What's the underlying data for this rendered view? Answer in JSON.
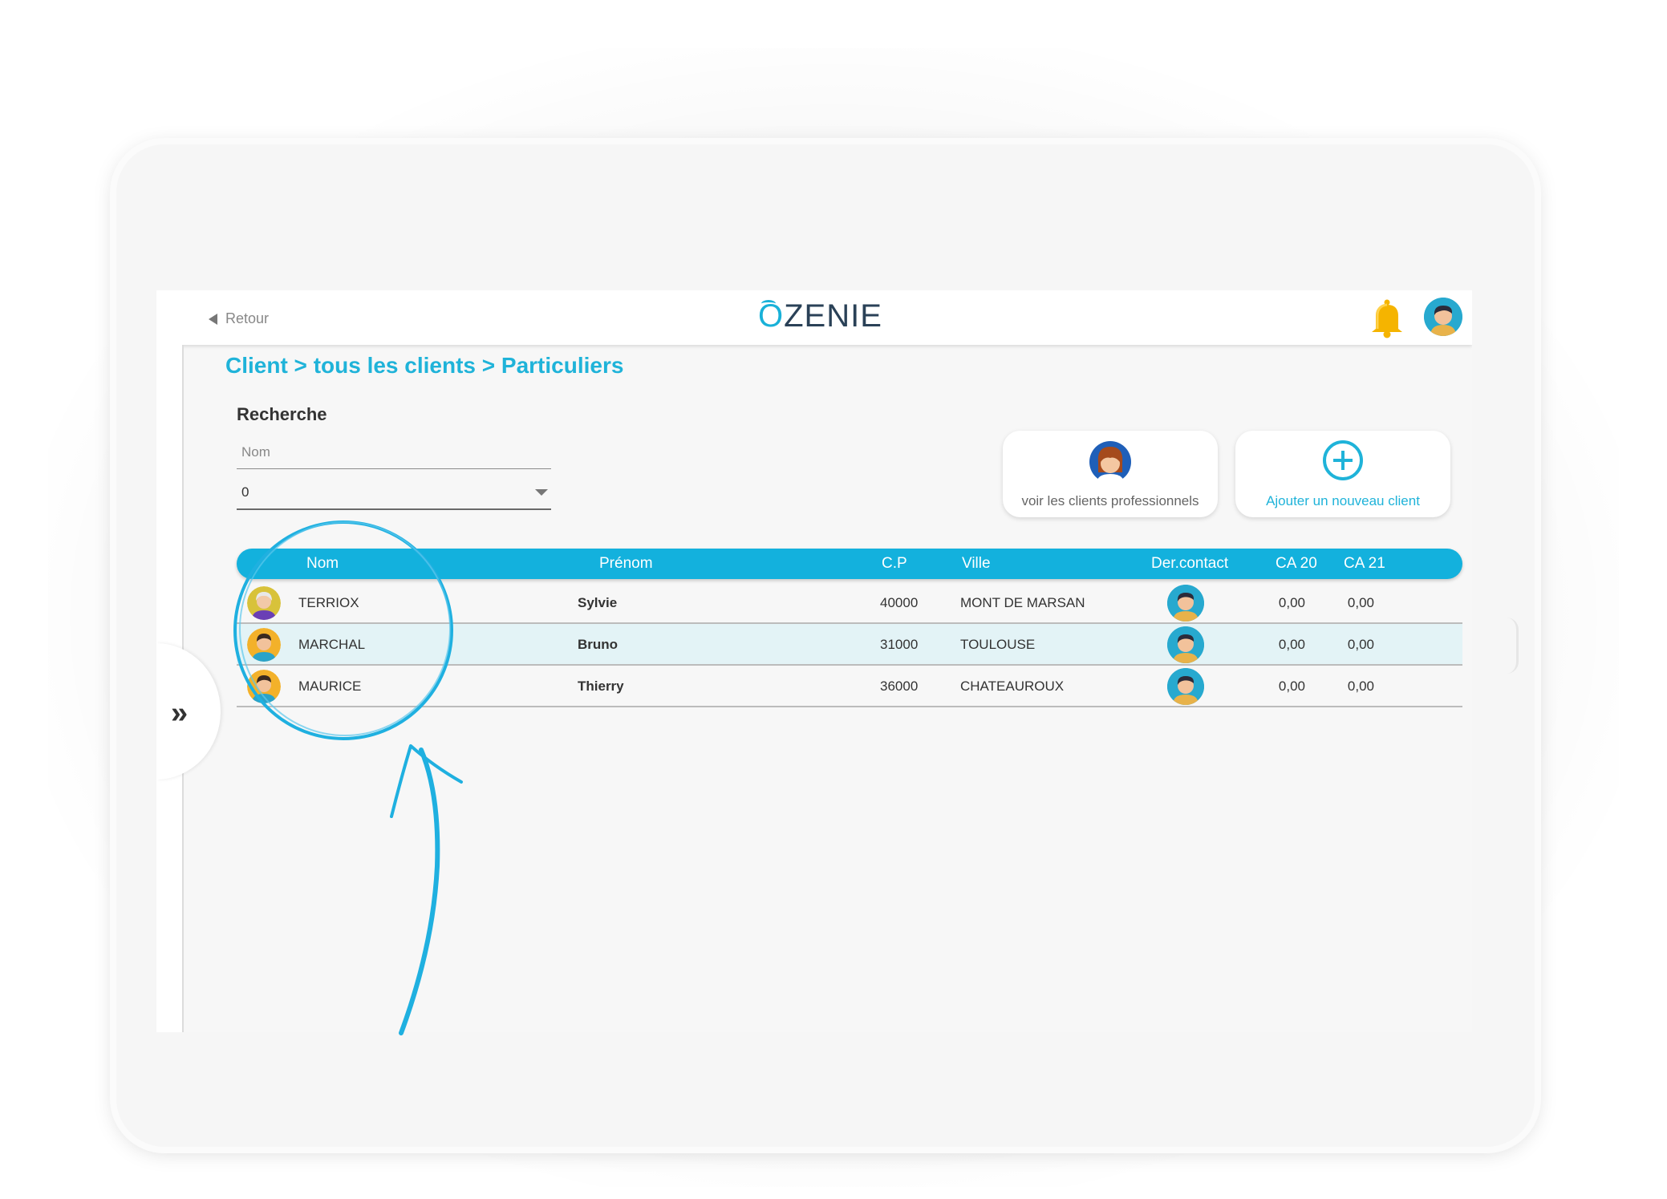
{
  "header": {
    "back_label": "Retour",
    "logo_text": "ZENIE",
    "logo_letter": "O"
  },
  "breadcrumb": "Client > tous les clients > Particuliers",
  "search": {
    "title": "Recherche",
    "name_placeholder": "Nom",
    "select_value": "0"
  },
  "actions": {
    "pro_clients_label": "voir les clients professionnels",
    "add_client_label": "Ajouter un nouveau client"
  },
  "table": {
    "headers": [
      "Nom",
      "Prénom",
      "C.P",
      "Ville",
      "Der.contact",
      "CA 20",
      "CA 21"
    ],
    "rows": [
      {
        "nom": "TERRIOX",
        "prenom": "Sylvie",
        "cp": "40000",
        "ville": "MONT DE MARSAN",
        "ca20": "0,00",
        "ca21": "0,00"
      },
      {
        "nom": "MARCHAL",
        "prenom": "Bruno",
        "cp": "31000",
        "ville": "TOULOUSE",
        "ca20": "0,00",
        "ca21": "0,00"
      },
      {
        "nom": "MAURICE",
        "prenom": "Thierry",
        "cp": "36000",
        "ville": "CHATEAUROUX",
        "ca20": "0,00",
        "ca21": "0,00"
      }
    ]
  },
  "colors": {
    "accent": "#13b1dd",
    "breadcrumb": "#1fb3d9",
    "bell": "#f5b400",
    "annotation": "#1fb0e0"
  }
}
